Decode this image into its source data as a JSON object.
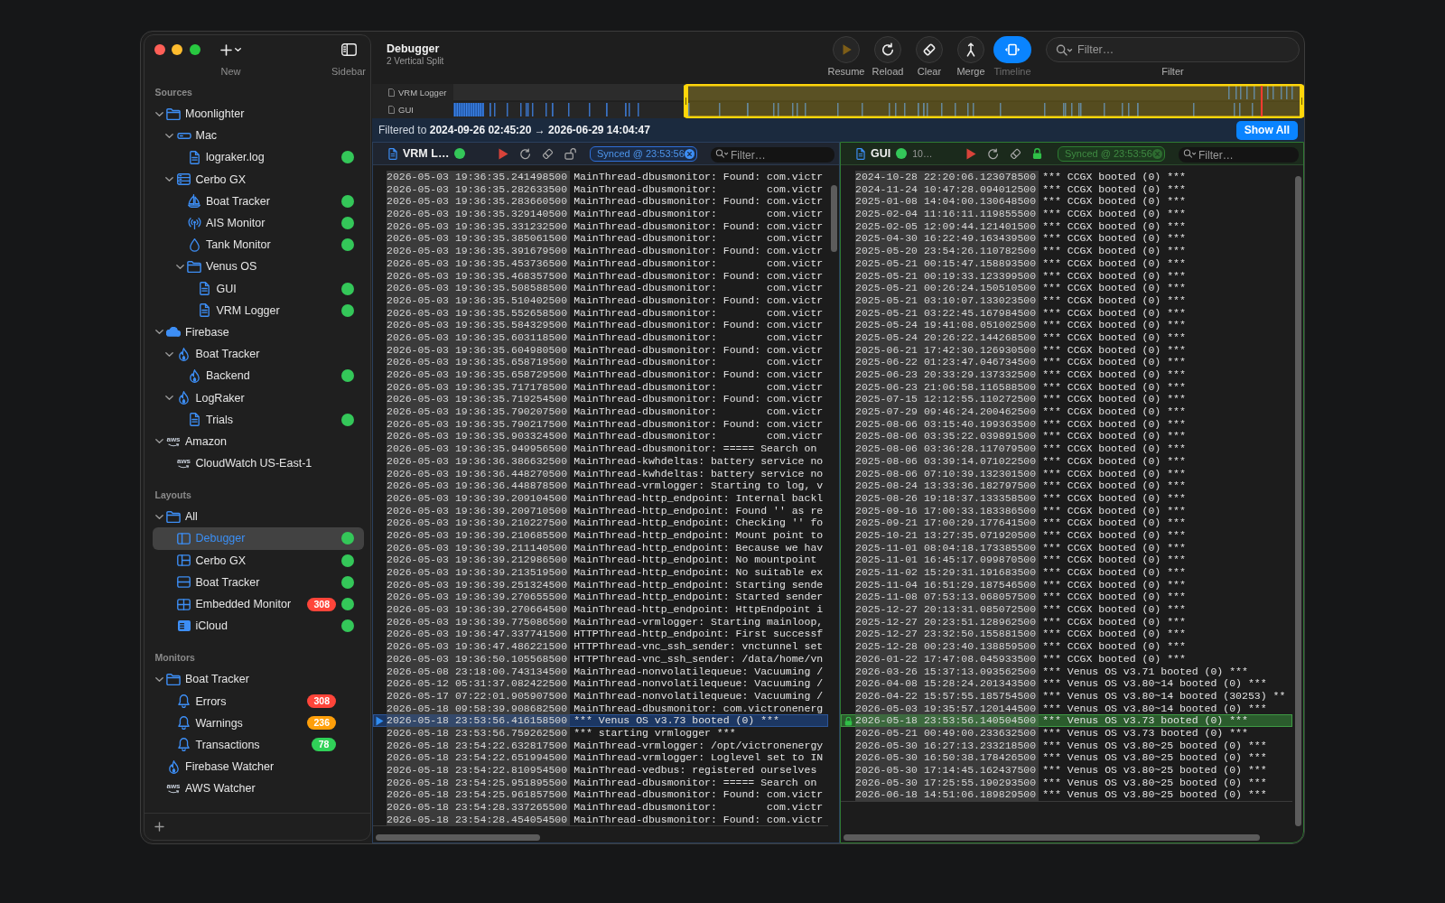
{
  "sidebar": {
    "tools": [
      {
        "kind": "new",
        "label": "New"
      },
      {
        "kind": "sidebar",
        "label": "Sidebar"
      }
    ],
    "sections": [
      {
        "title": "Sources",
        "items": [
          {
            "label": "Moonlighter",
            "kind": "folder",
            "expanded": true,
            "online": false,
            "selected": false,
            "children": [
              {
                "label": "Mac",
                "kind": "computer",
                "expanded": true,
                "online": false,
                "selected": false,
                "children": [
                  {
                    "label": "lograker.log",
                    "kind": "file",
                    "online": true,
                    "selected": false
                  }
                ]
              },
              {
                "label": "Cerbo GX",
                "kind": "server",
                "expanded": true,
                "online": false,
                "selected": false,
                "children": [
                  {
                    "label": "Boat Tracker",
                    "kind": "sailboat",
                    "online": true,
                    "selected": false
                  },
                  {
                    "label": "AIS Monitor",
                    "kind": "antenna",
                    "online": true,
                    "selected": false
                  },
                  {
                    "label": "Tank Monitor",
                    "kind": "drop",
                    "online": true,
                    "selected": false
                  },
                  {
                    "label": "Venus OS",
                    "kind": "folder",
                    "expanded": true,
                    "online": false,
                    "selected": false,
                    "children": [
                      {
                        "label": "GUI",
                        "kind": "file",
                        "online": true,
                        "selected": false
                      },
                      {
                        "label": "VRM Logger",
                        "kind": "file",
                        "online": true,
                        "selected": false
                      }
                    ]
                  }
                ]
              }
            ]
          },
          {
            "label": "Firebase",
            "kind": "cloud",
            "expanded": true,
            "online": false,
            "selected": false,
            "children": [
              {
                "label": "Boat Tracker",
                "kind": "flame",
                "expanded": true,
                "online": false,
                "selected": false,
                "children": [
                  {
                    "label": "Backend",
                    "kind": "flame",
                    "online": true,
                    "selected": false
                  }
                ]
              },
              {
                "label": "LogRaker",
                "kind": "flame",
                "expanded": true,
                "online": false,
                "selected": false,
                "children": [
                  {
                    "label": "Trials",
                    "kind": "file",
                    "online": true,
                    "selected": false
                  }
                ]
              }
            ]
          },
          {
            "label": "Amazon",
            "kind": "aws",
            "logo": "aws",
            "expanded": true,
            "online": false,
            "selected": false,
            "children": [
              {
                "label": "CloudWatch US-East-1",
                "kind": "aws",
                "logo": "aws",
                "online": false,
                "selected": false
              }
            ]
          }
        ]
      },
      {
        "title": "Layouts",
        "items": [
          {
            "label": "All",
            "kind": "folder",
            "expanded": true,
            "online": false,
            "selected": false,
            "children": [
              {
                "label": "Debugger",
                "kind": "split",
                "online": true,
                "selected": true
              },
              {
                "label": "Cerbo GX",
                "kind": "panels",
                "online": true,
                "selected": false
              },
              {
                "label": "Boat Tracker",
                "kind": "rows",
                "online": true,
                "selected": false
              },
              {
                "label": "Embedded Monitor",
                "kind": "grid",
                "badge": {
                  "text": "308",
                  "color": "#ff453a"
                },
                "online": true,
                "selected": false
              },
              {
                "label": "iCloud",
                "kind": "list",
                "online": true,
                "selected": false
              }
            ]
          }
        ]
      },
      {
        "title": "Monitors",
        "items": [
          {
            "label": "Boat Tracker",
            "kind": "folder",
            "expanded": true,
            "online": false,
            "selected": false,
            "children": [
              {
                "label": "Errors",
                "kind": "bell",
                "badge": {
                  "text": "308",
                  "color": "#ff453a"
                },
                "online": false,
                "selected": false
              },
              {
                "label": "Warnings",
                "kind": "bell",
                "badge": {
                  "text": "236",
                  "color": "#ff9f0a"
                },
                "online": false,
                "selected": false
              },
              {
                "label": "Transactions",
                "kind": "bell",
                "badge": {
                  "text": "78",
                  "color": "#30d158"
                },
                "online": false,
                "selected": false
              }
            ]
          },
          {
            "label": "Firebase Watcher",
            "kind": "flame",
            "online": false,
            "selected": false
          },
          {
            "label": "AWS Watcher",
            "kind": "aws",
            "logo": "aws",
            "online": false,
            "selected": false
          }
        ]
      }
    ]
  },
  "toolbar": {
    "title": "Debugger",
    "subtitle": "2 Vertical Split",
    "buttons": [
      {
        "kind": "resume",
        "label": "Resume",
        "disabled": true,
        "selected": false
      },
      {
        "kind": "reload",
        "label": "Reload",
        "disabled": false,
        "selected": false
      },
      {
        "kind": "clear",
        "label": "Clear",
        "disabled": false,
        "selected": false
      },
      {
        "kind": "merge",
        "label": "Merge",
        "disabled": false,
        "selected": false
      },
      {
        "kind": "timeline",
        "label": "Timeline",
        "disabled": false,
        "selected": true
      }
    ],
    "filter": {
      "placeholder": "Filter…",
      "label": "Filter"
    }
  },
  "timeline": {
    "rows": [
      {
        "label": "VRM Logger"
      },
      {
        "label": "GUI"
      }
    ]
  },
  "filter_bar": {
    "text": "Filtered to **2024-09-26 02:45:20 → 2026-06-29 14:04:47**",
    "button": "Show All"
  },
  "panes": [
    {
      "title": "VRM L…",
      "online": true,
      "locked": false,
      "sync": "Synced @ 23:53:56",
      "filter": {
        "placeholder": "Filter…"
      },
      "lines": [
        {
          "timestamp": "2026-05-03 19:36:35.241498500",
          "message": "MainThread-dbusmonitor: Found: com.victr",
          "selected": false
        },
        {
          "timestamp": "2026-05-03 19:36:35.282633500",
          "message": "MainThread-dbusmonitor:        com.victr",
          "selected": false
        },
        {
          "timestamp": "2026-05-03 19:36:35.283660500",
          "message": "MainThread-dbusmonitor: Found: com.victr",
          "selected": false
        },
        {
          "timestamp": "2026-05-03 19:36:35.329140500",
          "message": "MainThread-dbusmonitor:        com.victr",
          "selected": false
        },
        {
          "timestamp": "2026-05-03 19:36:35.331232500",
          "message": "MainThread-dbusmonitor: Found: com.victr",
          "selected": false
        },
        {
          "timestamp": "2026-05-03 19:36:35.385061500",
          "message": "MainThread-dbusmonitor:        com.victr",
          "selected": false
        },
        {
          "timestamp": "2026-05-03 19:36:35.391679500",
          "message": "MainThread-dbusmonitor: Found: com.victr",
          "selected": false
        },
        {
          "timestamp": "2026-05-03 19:36:35.453736500",
          "message": "MainThread-dbusmonitor:        com.victr",
          "selected": false
        },
        {
          "timestamp": "2026-05-03 19:36:35.468357500",
          "message": "MainThread-dbusmonitor: Found: com.victr",
          "selected": false
        },
        {
          "timestamp": "2026-05-03 19:36:35.508588500",
          "message": "MainThread-dbusmonitor:        com.victr",
          "selected": false
        },
        {
          "timestamp": "2026-05-03 19:36:35.510402500",
          "message": "MainThread-dbusmonitor: Found: com.victr",
          "selected": false
        },
        {
          "timestamp": "2026-05-03 19:36:35.552658500",
          "message": "MainThread-dbusmonitor:        com.victr",
          "selected": false
        },
        {
          "timestamp": "2026-05-03 19:36:35.584329500",
          "message": "MainThread-dbusmonitor: Found: com.victr",
          "selected": false
        },
        {
          "timestamp": "2026-05-03 19:36:35.603118500",
          "message": "MainThread-dbusmonitor:        com.victr",
          "selected": false
        },
        {
          "timestamp": "2026-05-03 19:36:35.604980500",
          "message": "MainThread-dbusmonitor: Found: com.victr",
          "selected": false
        },
        {
          "timestamp": "2026-05-03 19:36:35.658719500",
          "message": "MainThread-dbusmonitor:        com.victr",
          "selected": false
        },
        {
          "timestamp": "2026-05-03 19:36:35.658729500",
          "message": "MainThread-dbusmonitor: Found: com.victr",
          "selected": false
        },
        {
          "timestamp": "2026-05-03 19:36:35.717178500",
          "message": "MainThread-dbusmonitor:        com.victr",
          "selected": false
        },
        {
          "timestamp": "2026-05-03 19:36:35.719254500",
          "message": "MainThread-dbusmonitor: Found: com.victr",
          "selected": false
        },
        {
          "timestamp": "2026-05-03 19:36:35.790207500",
          "message": "MainThread-dbusmonitor:        com.victr",
          "selected": false
        },
        {
          "timestamp": "2026-05-03 19:36:35.790217500",
          "message": "MainThread-dbusmonitor: Found: com.victr",
          "selected": false
        },
        {
          "timestamp": "2026-05-03 19:36:35.903324500",
          "message": "MainThread-dbusmonitor:        com.victr",
          "selected": false
        },
        {
          "timestamp": "2026-05-03 19:36:35.949956500",
          "message": "MainThread-dbusmonitor: ===== Search on",
          "selected": false
        },
        {
          "timestamp": "2026-05-03 19:36:36.386632500",
          "message": "MainThread-kwhdeltas: battery service no",
          "selected": false
        },
        {
          "timestamp": "2026-05-03 19:36:36.448270500",
          "message": "MainThread-kwhdeltas: battery service no",
          "selected": false
        },
        {
          "timestamp": "2026-05-03 19:36:36.448878500",
          "message": "MainThread-vrmlogger: Starting to log, v",
          "selected": false
        },
        {
          "timestamp": "2026-05-03 19:36:39.209104500",
          "message": "MainThread-http_endpoint: Internal backl",
          "selected": false
        },
        {
          "timestamp": "2026-05-03 19:36:39.209710500",
          "message": "MainThread-http_endpoint: Found '' as re",
          "selected": false
        },
        {
          "timestamp": "2026-05-03 19:36:39.210227500",
          "message": "MainThread-http_endpoint: Checking '' fo",
          "selected": false
        },
        {
          "timestamp": "2026-05-03 19:36:39.210685500",
          "message": "MainThread-http_endpoint: Mount point to",
          "selected": false
        },
        {
          "timestamp": "2026-05-03 19:36:39.211140500",
          "message": "MainThread-http_endpoint: Because we hav",
          "selected": false
        },
        {
          "timestamp": "2026-05-03 19:36:39.212986500",
          "message": "MainThread-http_endpoint: No mountpoint",
          "selected": false
        },
        {
          "timestamp": "2026-05-03 19:36:39.213519500",
          "message": "MainThread-http_endpoint: No suitable ex",
          "selected": false
        },
        {
          "timestamp": "2026-05-03 19:36:39.251324500",
          "message": "MainThread-http_endpoint: Starting sende",
          "selected": false
        },
        {
          "timestamp": "2026-05-03 19:36:39.270655500",
          "message": "MainThread-http_endpoint: Started sender",
          "selected": false
        },
        {
          "timestamp": "2026-05-03 19:36:39.270664500",
          "message": "MainThread-http_endpoint: HttpEndpoint i",
          "selected": false
        },
        {
          "timestamp": "2026-05-03 19:36:39.775086500",
          "message": "MainThread-vrmlogger: Starting mainloop,",
          "selected": false
        },
        {
          "timestamp": "2026-05-03 19:36:47.337741500",
          "message": "HTTPThread-http_endpoint: First successf",
          "selected": false
        },
        {
          "timestamp": "2026-05-03 19:36:47.486221500",
          "message": "HTTPThread-vnc_ssh_sender: vnctunnel set",
          "selected": false
        },
        {
          "timestamp": "2026-05-03 19:36:50.105568500",
          "message": "HTTPThread-vnc_ssh_sender: /data/home/vn",
          "selected": false
        },
        {
          "timestamp": "2026-05-08 23:18:00.743134500",
          "message": "MainThread-nonvolatilequeue: Vacuuming /",
          "selected": false
        },
        {
          "timestamp": "2026-05-12 05:31:37.082422500",
          "message": "MainThread-nonvolatilequeue: Vacuuming /",
          "selected": false
        },
        {
          "timestamp": "2026-05-17 07:22:01.905907500",
          "message": "MainThread-nonvolatilequeue: Vacuuming /",
          "selected": false
        },
        {
          "timestamp": "2026-05-18 09:58:39.908682500",
          "message": "MainThread-dbusmonitor: com.victronenerg",
          "selected": false
        },
        {
          "timestamp": "2026-05-18 23:53:56.416158500",
          "message": "*** Venus OS v3.73 booted (0) ***",
          "selected": true
        },
        {
          "timestamp": "2026-05-18 23:53:56.759262500",
          "message": "*** starting vrmlogger ***",
          "selected": false
        },
        {
          "timestamp": "2026-05-18 23:54:22.632817500",
          "message": "MainThread-vrmlogger: /opt/victronenergy",
          "selected": false
        },
        {
          "timestamp": "2026-05-18 23:54:22.651994500",
          "message": "MainThread-vrmlogger: Loglevel set to IN",
          "selected": false
        },
        {
          "timestamp": "2026-05-18 23:54:22.810954500",
          "message": "MainThread-vedbus: registered ourselves",
          "selected": false
        },
        {
          "timestamp": "2026-05-18 23:54:25.951895500",
          "message": "MainThread-dbusmonitor: ===== Search on",
          "selected": false
        },
        {
          "timestamp": "2026-05-18 23:54:25.961857500",
          "message": "MainThread-dbusmonitor: Found: com.victr",
          "selected": false
        },
        {
          "timestamp": "2026-05-18 23:54:28.337265500",
          "message": "MainThread-dbusmonitor:        com.victr",
          "selected": false
        },
        {
          "timestamp": "2026-05-18 23:54:28.454054500",
          "message": "MainThread-dbusmonitor: Found: com.victr",
          "selected": false
        }
      ]
    },
    {
      "title": "GUI",
      "online": true,
      "detail": "10…",
      "locked": true,
      "sync": "Synced @ 23:53:56",
      "filter": {
        "placeholder": "Filter…"
      },
      "lines": [
        {
          "timestamp": "2024-10-28 22:20:06.123078500",
          "message": "*** CCGX booted (0) ***",
          "selected": false
        },
        {
          "timestamp": "2024-11-24 10:47:28.094012500",
          "message": "*** CCGX booted (0) ***",
          "selected": false
        },
        {
          "timestamp": "2025-01-08 14:04:00.130648500",
          "message": "*** CCGX booted (0) ***",
          "selected": false
        },
        {
          "timestamp": "2025-02-04 11:16:11.119855500",
          "message": "*** CCGX booted (0) ***",
          "selected": false
        },
        {
          "timestamp": "2025-02-05 12:09:44.121401500",
          "message": "*** CCGX booted (0) ***",
          "selected": false
        },
        {
          "timestamp": "2025-04-30 16:22:49.163439500",
          "message": "*** CCGX booted (0) ***",
          "selected": false
        },
        {
          "timestamp": "2025-05-20 23:54:26.110782500",
          "message": "*** CCGX booted (0) ***",
          "selected": false
        },
        {
          "timestamp": "2025-05-21 00:15:47.158893500",
          "message": "*** CCGX booted (0) ***",
          "selected": false
        },
        {
          "timestamp": "2025-05-21 00:19:33.123399500",
          "message": "*** CCGX booted (0) ***",
          "selected": false
        },
        {
          "timestamp": "2025-05-21 00:26:24.150510500",
          "message": "*** CCGX booted (0) ***",
          "selected": false
        },
        {
          "timestamp": "2025-05-21 03:10:07.133023500",
          "message": "*** CCGX booted (0) ***",
          "selected": false
        },
        {
          "timestamp": "2025-05-21 03:22:45.167984500",
          "message": "*** CCGX booted (0) ***",
          "selected": false
        },
        {
          "timestamp": "2025-05-24 19:41:08.051002500",
          "message": "*** CCGX booted (0) ***",
          "selected": false
        },
        {
          "timestamp": "2025-05-24 20:26:22.144268500",
          "message": "*** CCGX booted (0) ***",
          "selected": false
        },
        {
          "timestamp": "2025-06-21 17:42:30.126930500",
          "message": "*** CCGX booted (0) ***",
          "selected": false
        },
        {
          "timestamp": "2025-06-22 01:23:47.046734500",
          "message": "*** CCGX booted (0) ***",
          "selected": false
        },
        {
          "timestamp": "2025-06-23 20:33:29.137332500",
          "message": "*** CCGX booted (0) ***",
          "selected": false
        },
        {
          "timestamp": "2025-06-23 21:06:58.116588500",
          "message": "*** CCGX booted (0) ***",
          "selected": false
        },
        {
          "timestamp": "2025-07-15 12:12:55.110272500",
          "message": "*** CCGX booted (0) ***",
          "selected": false
        },
        {
          "timestamp": "2025-07-29 09:46:24.200462500",
          "message": "*** CCGX booted (0) ***",
          "selected": false
        },
        {
          "timestamp": "2025-08-06 03:15:40.199363500",
          "message": "*** CCGX booted (0) ***",
          "selected": false
        },
        {
          "timestamp": "2025-08-06 03:35:22.039891500",
          "message": "*** CCGX booted (0) ***",
          "selected": false
        },
        {
          "timestamp": "2025-08-06 03:36:28.117079500",
          "message": "*** CCGX booted (0) ***",
          "selected": false
        },
        {
          "timestamp": "2025-08-06 03:39:14.071022500",
          "message": "*** CCGX booted (0) ***",
          "selected": false
        },
        {
          "timestamp": "2025-08-06 07:10:39.132301500",
          "message": "*** CCGX booted (0) ***",
          "selected": false
        },
        {
          "timestamp": "2025-08-24 13:33:36.182797500",
          "message": "*** CCGX booted (0) ***",
          "selected": false
        },
        {
          "timestamp": "2025-08-26 19:18:37.133358500",
          "message": "*** CCGX booted (0) ***",
          "selected": false
        },
        {
          "timestamp": "2025-09-16 17:00:33.183386500",
          "message": "*** CCGX booted (0) ***",
          "selected": false
        },
        {
          "timestamp": "2025-09-21 17:00:29.177641500",
          "message": "*** CCGX booted (0) ***",
          "selected": false
        },
        {
          "timestamp": "2025-10-21 13:27:35.071920500",
          "message": "*** CCGX booted (0) ***",
          "selected": false
        },
        {
          "timestamp": "2025-11-01 08:04:18.173385500",
          "message": "*** CCGX booted (0) ***",
          "selected": false
        },
        {
          "timestamp": "2025-11-01 16:45:17.099870500",
          "message": "*** CCGX booted (0) ***",
          "selected": false
        },
        {
          "timestamp": "2025-11-02 15:29:31.191683500",
          "message": "*** CCGX booted (0) ***",
          "selected": false
        },
        {
          "timestamp": "2025-11-04 16:51:29.187546500",
          "message": "*** CCGX booted (0) ***",
          "selected": false
        },
        {
          "timestamp": "2025-11-08 07:53:13.068057500",
          "message": "*** CCGX booted (0) ***",
          "selected": false
        },
        {
          "timestamp": "2025-12-27 20:13:31.085072500",
          "message": "*** CCGX booted (0) ***",
          "selected": false
        },
        {
          "timestamp": "2025-12-27 20:23:51.128962500",
          "message": "*** CCGX booted (0) ***",
          "selected": false
        },
        {
          "timestamp": "2025-12-27 23:32:50.155881500",
          "message": "*** CCGX booted (0) ***",
          "selected": false
        },
        {
          "timestamp": "2025-12-28 00:23:40.138859500",
          "message": "*** CCGX booted (0) ***",
          "selected": false
        },
        {
          "timestamp": "2026-01-22 17:47:08.045933500",
          "message": "*** CCGX booted (0) ***",
          "selected": false
        },
        {
          "timestamp": "2026-03-26 15:37:13.093562500",
          "message": "*** Venus OS v3.71 booted (0) ***",
          "selected": false
        },
        {
          "timestamp": "2026-04-08 15:28:24.201343500",
          "message": "*** Venus OS v3.80~14 booted (0) ***",
          "selected": false
        },
        {
          "timestamp": "2026-04-22 15:57:55.185754500",
          "message": "*** Venus OS v3.80~14 booted (30253) **",
          "selected": false
        },
        {
          "timestamp": "2026-05-03 19:35:57.120144500",
          "message": "*** Venus OS v3.80~14 booted (0) ***",
          "selected": false
        },
        {
          "timestamp": "2026-05-18 23:53:56.140504500",
          "message": "*** Venus OS v3.73 booted (0) ***",
          "selected": true
        },
        {
          "timestamp": "2026-05-21 00:49:00.233632500",
          "message": "*** Venus OS v3.73 booted (0) ***",
          "selected": false
        },
        {
          "timestamp": "2026-05-30 16:27:13.233218500",
          "message": "*** Venus OS v3.80~25 booted (0) ***",
          "selected": false
        },
        {
          "timestamp": "2026-05-30 16:50:38.178426500",
          "message": "*** Venus OS v3.80~25 booted (0) ***",
          "selected": false
        },
        {
          "timestamp": "2026-05-30 17:14:45.162437500",
          "message": "*** Venus OS v3.80~25 booted (0) ***",
          "selected": false
        },
        {
          "timestamp": "2026-05-30 17:25:55.190293500",
          "message": "*** Venus OS v3.80~25 booted (0) ***",
          "selected": false
        },
        {
          "timestamp": "2026-06-18 14:51:06.189829500",
          "message": "*** Venus OS v3.80~25 booted (0) ***",
          "selected": false
        }
      ]
    }
  ]
}
